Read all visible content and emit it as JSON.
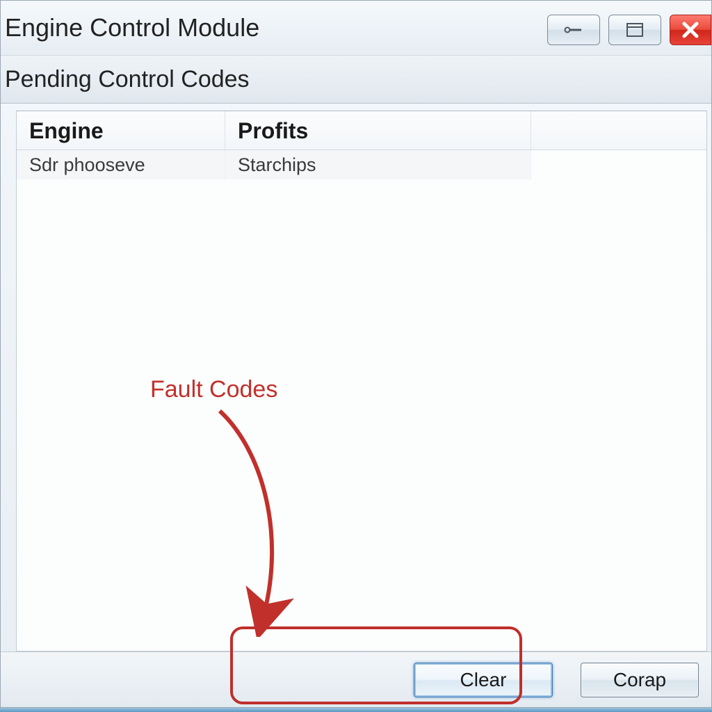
{
  "window": {
    "title": "Engine Control Module",
    "subtitle": "Pending Control Codes"
  },
  "table": {
    "headers": [
      "Engine",
      "Profits"
    ],
    "row": {
      "col0": "Sdr phooseve",
      "col1": "Starchips"
    }
  },
  "buttons": {
    "clear": "Clear",
    "corap": "Corap"
  },
  "annotation": {
    "label": "Fault Codes"
  }
}
